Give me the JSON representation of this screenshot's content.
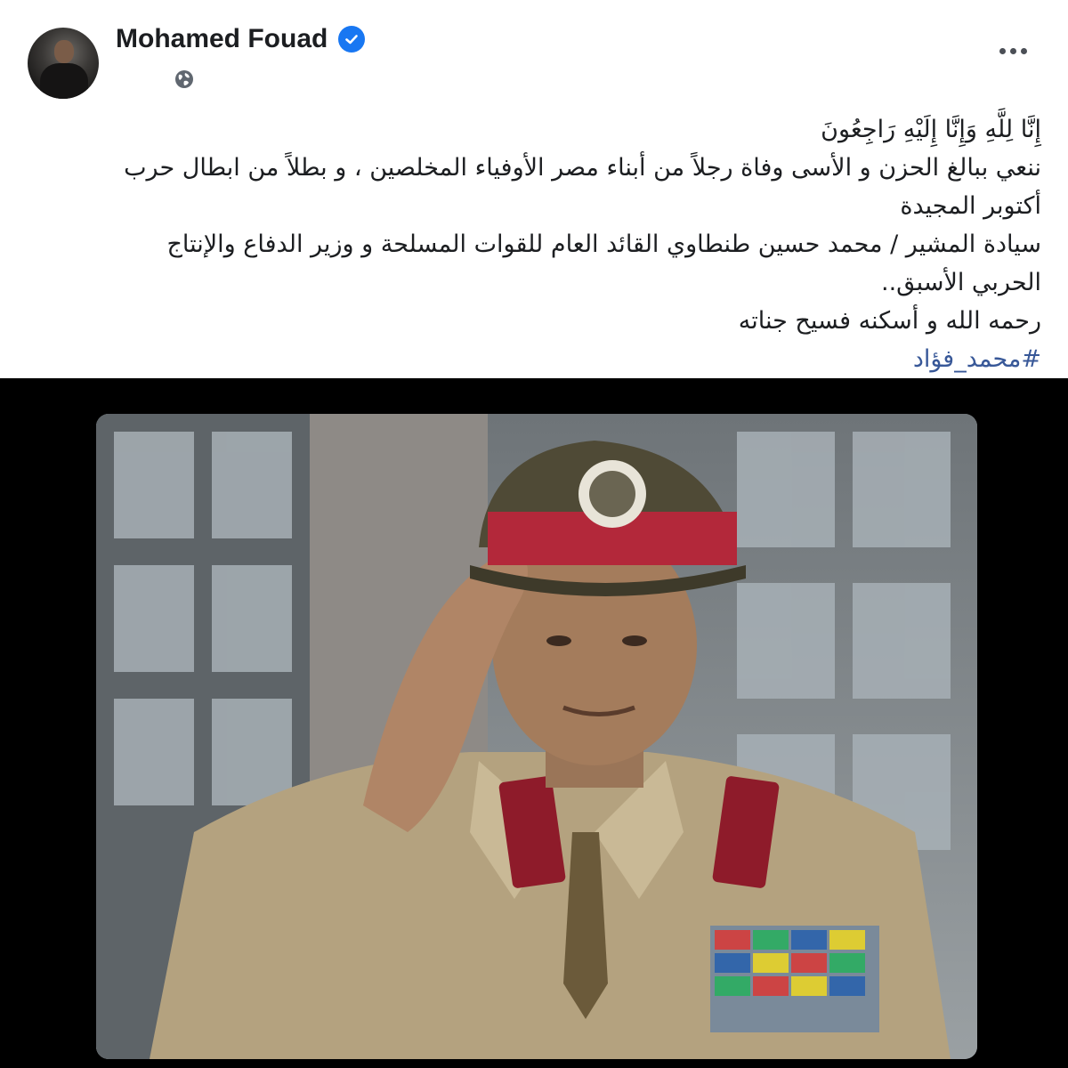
{
  "post": {
    "author": {
      "name": "Mohamed Fouad",
      "verified": true,
      "avatar_icon": "profile-avatar",
      "privacy_icon": "globe-icon"
    },
    "more_icon": "more-options-icon",
    "text_lines": [
      "إِنَّا لِلَّهِ وَإِنَّا إِلَيْهِ رَاجِعُونَ",
      "ننعي ببالغ الحزن و الأسى وفاة رجلاً من أبناء مصر الأوفياء المخلصين ، و بطلاً من ابطال حرب",
      "أكتوبر المجيدة",
      "سيادة المشير / محمد حسين طنطاوي القائد العام للقوات المسلحة و وزير الدفاع والإنتاج",
      "الحربي الأسبق..",
      "رحمه الله و أسكنه فسيح جناته"
    ],
    "hashtag": "#محمد_فؤاد",
    "photo": {
      "description_icon": "saluting-officer-photo"
    }
  },
  "colors": {
    "verified_badge": "#1877f2",
    "hashtag": "#385898",
    "text": "#1c1e21",
    "photo_background": "#000000"
  }
}
